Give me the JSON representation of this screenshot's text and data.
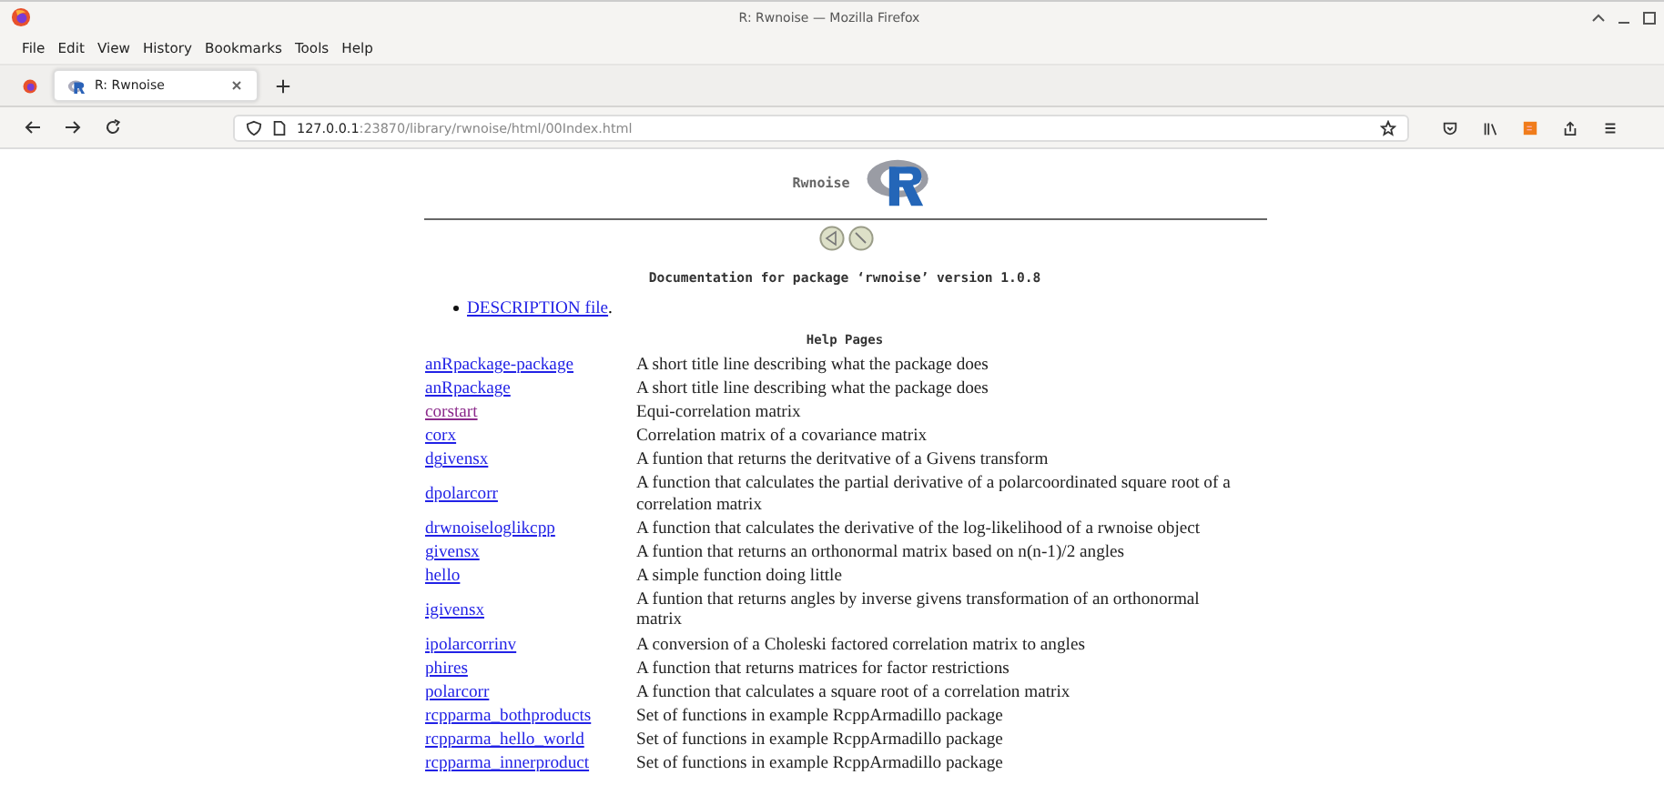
{
  "window": {
    "title": "R: Rwnoise — Mozilla Firefox"
  },
  "menu": [
    "File",
    "Edit",
    "View",
    "History",
    "Bookmarks",
    "Tools",
    "Help"
  ],
  "tabs": [
    {
      "label": "R: Rwnoise",
      "selected": true
    }
  ],
  "address": {
    "host": "127.0.0.1",
    "rest": ":23870/library/rwnoise/html/00Index.html"
  },
  "page": {
    "package_name": "Rwnoise",
    "heading": "Documentation for package ‘rwnoise’ version 1.0.8",
    "description_link": "DESCRIPTION file",
    "description_suffix": ".",
    "section_title": "Help Pages",
    "rows": [
      {
        "topic": "anRpackage-package",
        "title": "A short title line describing what the package does",
        "visited": false
      },
      {
        "topic": "anRpackage",
        "title": "A short title line describing what the package does",
        "visited": false
      },
      {
        "topic": "corstart",
        "title": "Equi-correlation matrix",
        "visited": true
      },
      {
        "topic": "corx",
        "title": "Correlation matrix of a covariance matrix",
        "visited": false
      },
      {
        "topic": "dgivensx",
        "title": "A funtion that returns the deritvative of a Givens transform",
        "visited": false
      },
      {
        "topic": "dpolarcorr",
        "title": "A function that calculates the partial derivative of a polarcoordinated square root of a correlation matrix",
        "visited": false
      },
      {
        "topic": "drwnoiseloglikcpp",
        "title": "A function that calculates the derivative of the log-likelihood of a rwnoise object",
        "visited": false
      },
      {
        "topic": "givensx",
        "title": "A funtion that returns an orthonormal matrix based on n(n-1)/2 angles",
        "visited": false
      },
      {
        "topic": "hello",
        "title": "A simple function doing little",
        "visited": false
      },
      {
        "topic": "igivensx",
        "title": "A funtion that returns angles by inverse givens transformation of an orthonormal matrix",
        "visited": false
      },
      {
        "topic": "ipolarcorrinv",
        "title": "A conversion of a Choleski factored correlation matrix to angles",
        "visited": false
      },
      {
        "topic": "phires",
        "title": "A function that returns matrices for factor restrictions",
        "visited": false
      },
      {
        "topic": "polarcorr",
        "title": "A function that calculates a square root of a correlation matrix",
        "visited": false
      },
      {
        "topic": "rcpparma_bothproducts",
        "title": "Set of functions in example RcppArmadillo package",
        "visited": false
      },
      {
        "topic": "rcpparma_hello_world",
        "title": "Set of functions in example RcppArmadillo package",
        "visited": false
      },
      {
        "topic": "rcpparma_innerproduct",
        "title": "Set of functions in example RcppArmadillo package",
        "visited": false
      }
    ]
  }
}
